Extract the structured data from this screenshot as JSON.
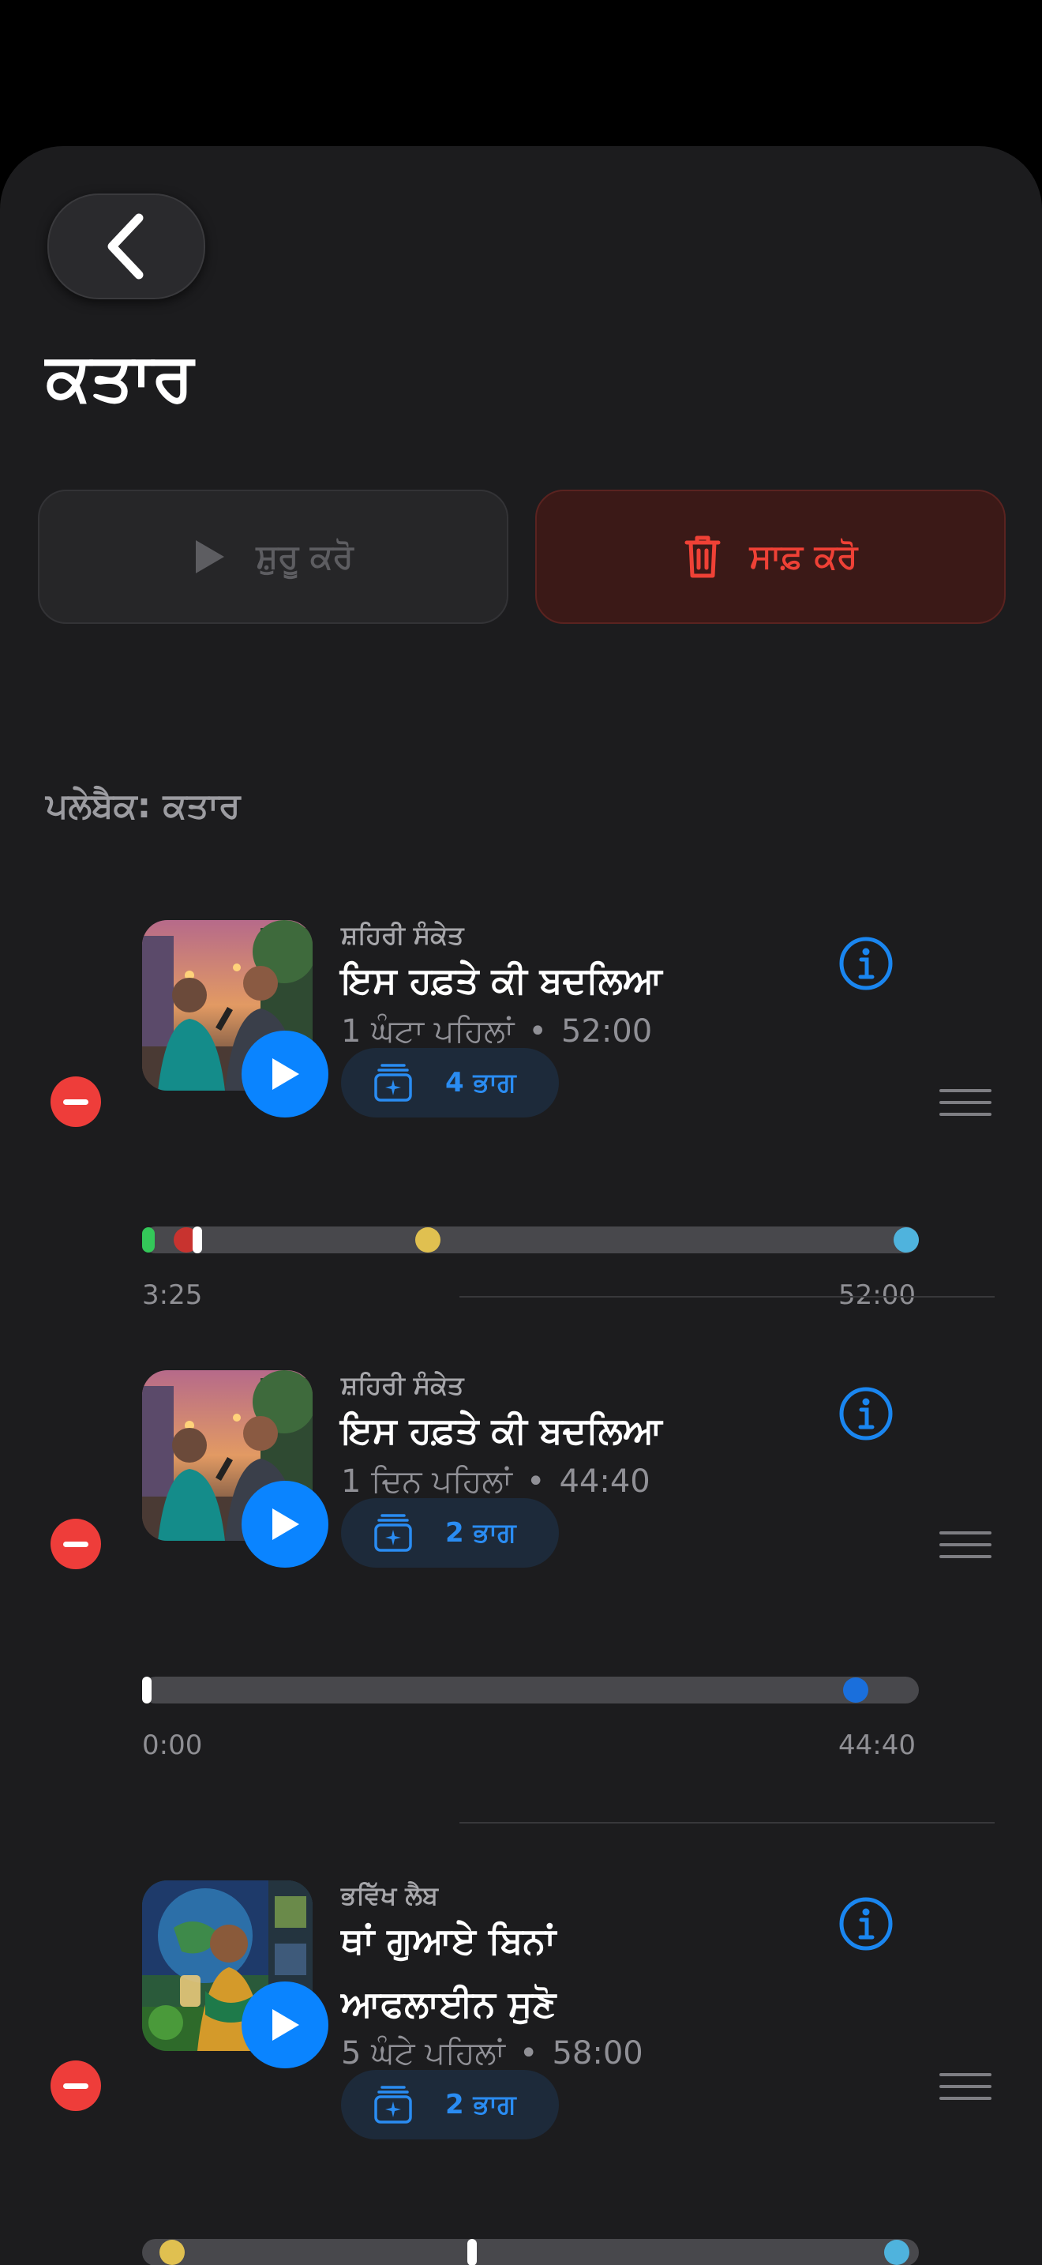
{
  "header": {
    "back_icon": "chevron-left-icon",
    "title": "ਕਤਾਰ"
  },
  "actions": {
    "start_label": "ਸ਼ੁਰੂ ਕਰੋ",
    "start_icon": "play-icon",
    "clear_label": "ਸਾਫ਼ ਕਰੋ",
    "clear_icon": "trash-icon"
  },
  "section_label": "ਪਲੇਬੈਕ: ਕਤਾਰ",
  "colors": {
    "accent": "#0a84ff",
    "destructive": "#ef4136",
    "background": "#1c1c1e"
  },
  "queue": [
    {
      "show": "ਸ਼ਹਿਰੀ ਸੰਕੇਤ",
      "title": "ਇਸ ਹਫ਼ਤੇ ਕੀ ਬਦਲਿਆ",
      "age": "1 ਘੰਟਾ ਪਹਿਲਾਂ",
      "duration": "52:00",
      "parts": "4 ਭਾਗ",
      "elapsed": "3:25",
      "total": "52:00",
      "progress": 0.066
    },
    {
      "show": "ਸ਼ਹਿਰੀ ਸੰਕੇਤ",
      "title": "ਇਸ ਹਫ਼ਤੇ ਕੀ ਬਦਲਿਆ",
      "age": "1 ਦਿਨ ਪਹਿਲਾਂ",
      "duration": "44:40",
      "parts": "2 ਭਾਗ",
      "elapsed": "0:00",
      "total": "44:40",
      "progress": 0.0
    },
    {
      "show": "ਭਵਿੱਖ ਲੈਬ",
      "title_line1": "ਥਾਂ ਗੁਆਏ ਬਿਨਾਂ",
      "title_line2": "ਆਫਲਾਈਨ ਸੁਣੋ",
      "age": "5 ਘੰਟੇ ਪਹਿਲਾਂ",
      "duration": "58:00",
      "parts": "2 ਭਾਗ",
      "progress": 0.42
    }
  ]
}
